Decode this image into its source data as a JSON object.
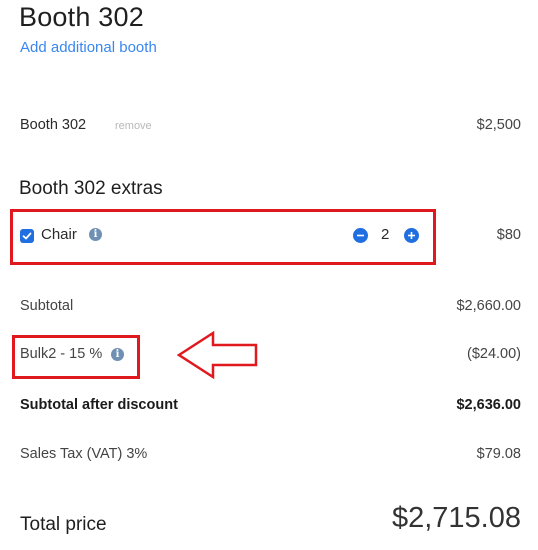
{
  "header": {
    "title": "Booth 302",
    "add_link": "Add additional booth"
  },
  "booth_row": {
    "label": "Booth 302",
    "remove_label": "remove",
    "price": "$2,500"
  },
  "extras": {
    "title": "Booth 302 extras",
    "items": [
      {
        "label": "Chair",
        "checked": true,
        "quantity": "2",
        "price": "$80"
      }
    ]
  },
  "summary": {
    "subtotal_label": "Subtotal",
    "subtotal_value": "$2,660.00",
    "discount_label": "Bulk2 - 15 %",
    "discount_value": "($24.00)",
    "after_discount_label": "Subtotal after discount",
    "after_discount_value": "$2,636.00",
    "tax_label": "Sales Tax (VAT) 3%",
    "tax_value": "$79.08",
    "total_label": "Total price",
    "total_value": "$2,715.08"
  },
  "icons": {
    "checkbox": "check-icon",
    "info": "info-icon",
    "minus": "minus-circle-icon",
    "plus": "plus-circle-icon",
    "arrow": "left-arrow-outline-icon"
  },
  "colors": {
    "accent": "#1f6fe0",
    "link": "#3a86f0",
    "highlight": "#e0191f",
    "info": "#6f8fb3"
  }
}
